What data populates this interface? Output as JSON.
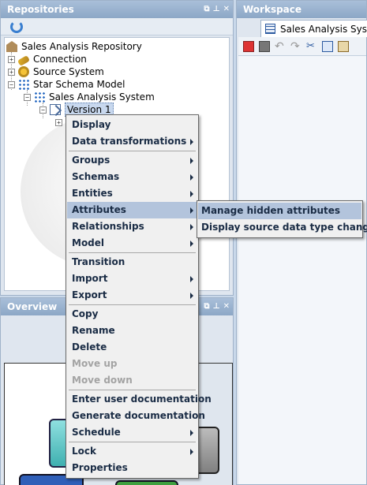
{
  "repositories": {
    "title": "Repositories",
    "header_icons": [
      "restore-icon",
      "pin-icon",
      "close-icon"
    ],
    "tree": [
      {
        "label": "Sales Analysis Repository",
        "icon": "repository-icon"
      },
      {
        "label": "Connection",
        "icon": "connection-icon"
      },
      {
        "label": "Source System",
        "icon": "source-system-icon"
      },
      {
        "label": "Star Schema Model",
        "icon": "star-schema-icon"
      },
      {
        "label": "Sales Analysis System",
        "icon": "star-schema-icon"
      },
      {
        "label": "Version 1",
        "icon": "version-icon"
      }
    ]
  },
  "overview": {
    "title": "Overview"
  },
  "workspace": {
    "title": "Workspace",
    "tab_label": "Sales Analysis System"
  },
  "context_menu": {
    "items": [
      {
        "label": "Display"
      },
      {
        "label": "Data transformations",
        "submenu": true
      },
      {
        "label": "Groups",
        "submenu": true
      },
      {
        "label": "Schemas",
        "submenu": true
      },
      {
        "label": "Entities",
        "submenu": true
      },
      {
        "label": "Attributes",
        "submenu": true,
        "active": true
      },
      {
        "label": "Relationships",
        "submenu": true
      },
      {
        "label": "Model",
        "submenu": true
      },
      {
        "label": "Transition"
      },
      {
        "label": "Import",
        "submenu": true
      },
      {
        "label": "Export",
        "submenu": true
      },
      {
        "label": "Copy"
      },
      {
        "label": "Rename"
      },
      {
        "label": "Delete"
      },
      {
        "label": "Move up",
        "disabled": true
      },
      {
        "label": "Move down",
        "disabled": true
      },
      {
        "label": "Enter user documentation"
      },
      {
        "label": "Generate documentation"
      },
      {
        "label": "Schedule",
        "submenu": true
      },
      {
        "label": "Lock",
        "submenu": true
      },
      {
        "label": "Properties"
      }
    ]
  },
  "attributes_submenu": {
    "items": [
      {
        "label": "Manage hidden attributes",
        "active": true
      },
      {
        "label": "Display source data type changes"
      }
    ]
  },
  "colors": {
    "panel_header": "#8ca7c6",
    "menu_highlight": "#b3c4dc",
    "menu_text": "#1a2c45",
    "disabled_text": "#a3a3a3"
  }
}
